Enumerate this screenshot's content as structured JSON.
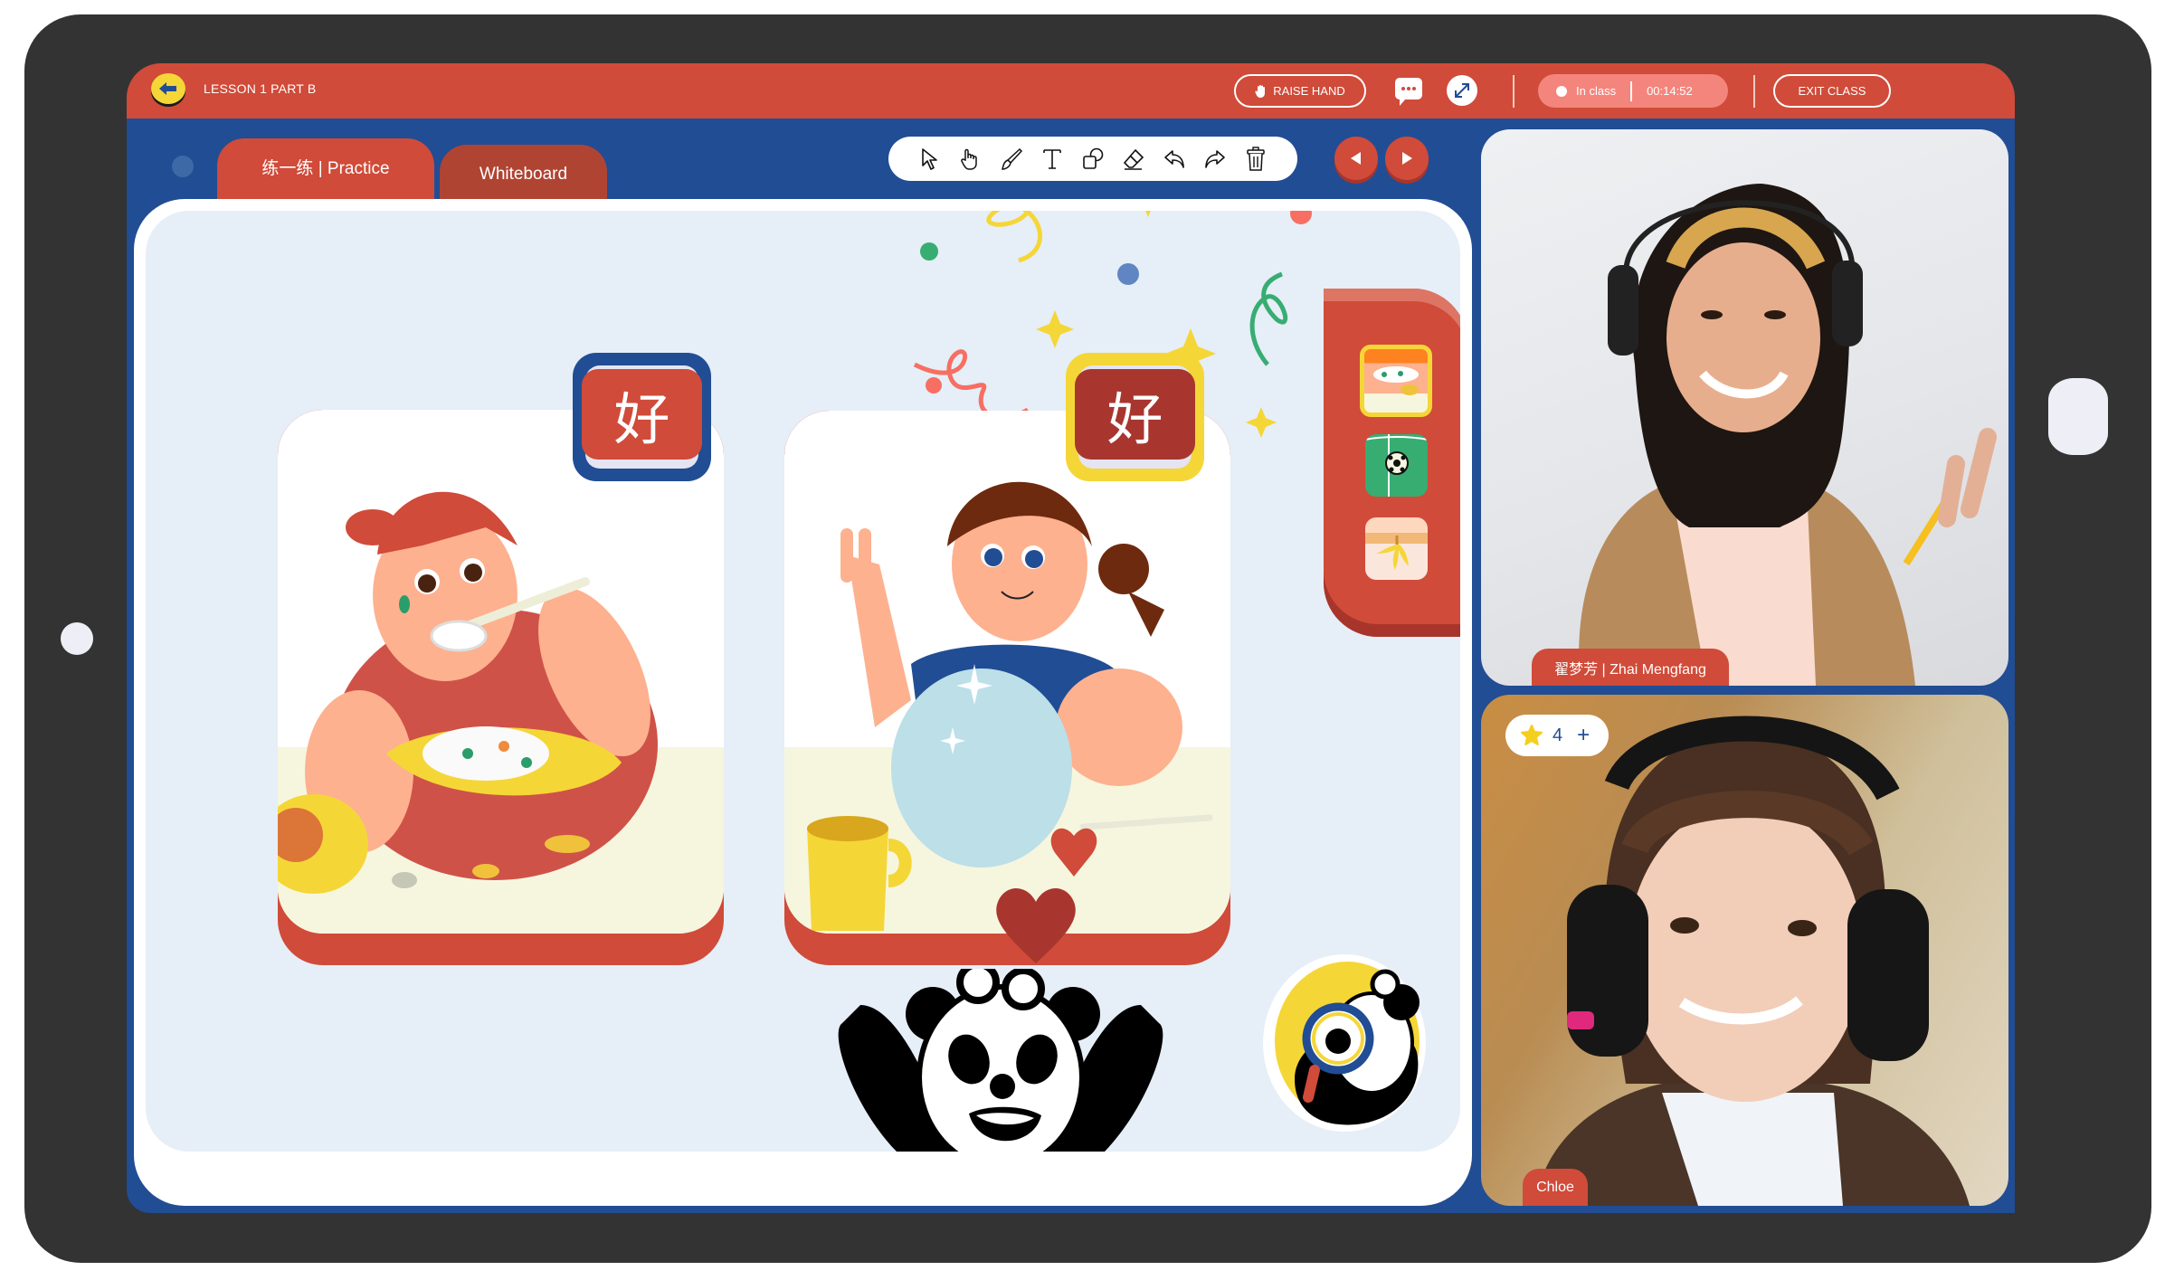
{
  "header": {
    "lesson_title": "LESSON 1 PART B",
    "raise_hand_label": "RAISE HAND",
    "status_label": "In class",
    "timer": "00:14:52",
    "exit_label": "EXIT CLASS",
    "icons": [
      "back-arrow-icon",
      "hand-icon",
      "chat-icon",
      "expand-icon"
    ]
  },
  "tabs": [
    {
      "label": "练一练 | Practice",
      "active": true
    },
    {
      "label": "Whiteboard",
      "active": false
    }
  ],
  "toolbar": {
    "tools": [
      "pointer",
      "hand",
      "brush",
      "text",
      "shapes",
      "eraser",
      "undo",
      "redo",
      "delete"
    ]
  },
  "navigation": {
    "prev": "previous-slide",
    "next": "next-slide"
  },
  "board": {
    "cards": [
      {
        "character": "好",
        "illustration": "boy eating rice messily",
        "badge_frame_color": "#214d94",
        "badge_color": "#d04b39"
      },
      {
        "character": "好",
        "illustration": "girl holding clean plate showing peace sign",
        "badge_frame_color": "#f5d637",
        "badge_color": "#a8362f"
      }
    ],
    "thumbnails": [
      "food-bowl",
      "soccer-field",
      "banana-peel"
    ],
    "selected_thumbnail": 0
  },
  "videos": {
    "teacher": {
      "name": "翟梦芳 | Zhai Mengfang"
    },
    "student": {
      "name": "Chloe",
      "stars": "4",
      "add_label": "+"
    }
  },
  "colors": {
    "header_red": "#d04b39",
    "app_blue": "#214d94",
    "accent_yellow": "#f5d637",
    "board_bg": "#e6eef7",
    "device": "#333333"
  }
}
